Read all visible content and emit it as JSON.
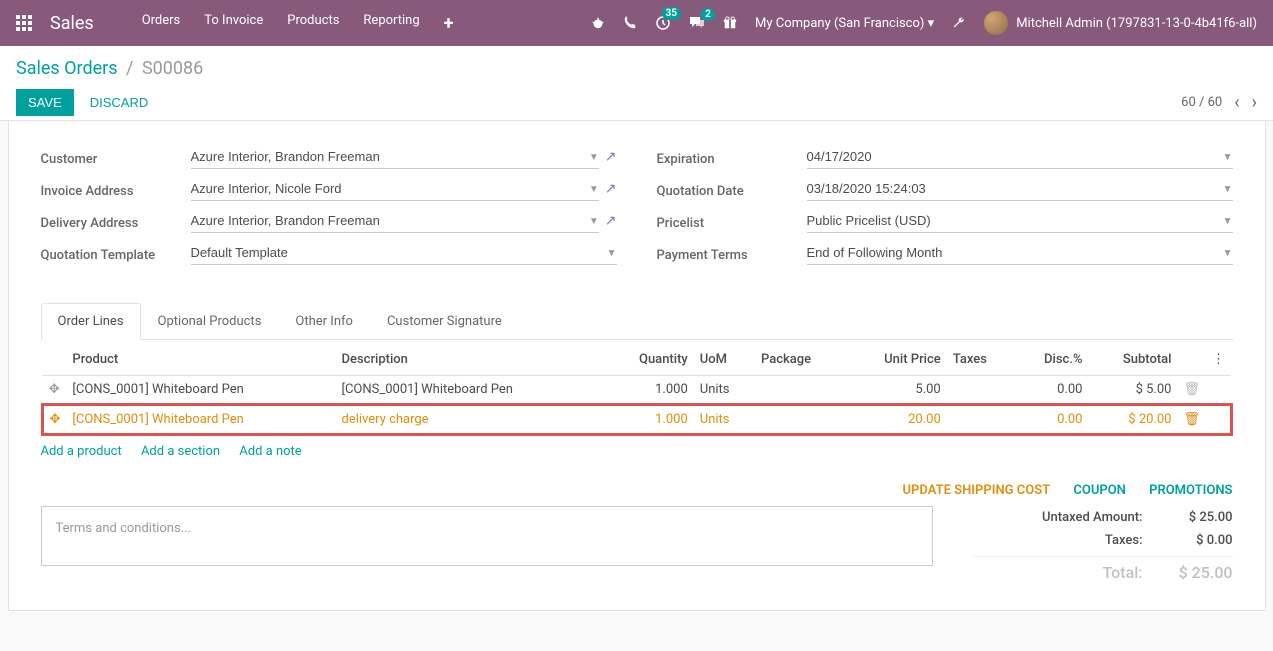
{
  "navbar": {
    "title": "Sales",
    "menu": [
      "Orders",
      "To Invoice",
      "Products",
      "Reporting"
    ],
    "activity_count": "35",
    "message_count": "2",
    "company": "My Company (San Francisco)",
    "user": "Mitchell Admin (1797831-13-0-4b41f6-all)"
  },
  "breadcrumb": {
    "parent": "Sales Orders",
    "current": "S00086"
  },
  "buttons": {
    "save": "SAVE",
    "discard": "DISCARD"
  },
  "pager": "60 / 60",
  "form": {
    "left": {
      "customer_label": "Customer",
      "customer": "Azure Interior, Brandon Freeman",
      "invoice_addr_label": "Invoice Address",
      "invoice_addr": "Azure Interior, Nicole Ford",
      "delivery_addr_label": "Delivery Address",
      "delivery_addr": "Azure Interior, Brandon Freeman",
      "template_label": "Quotation Template",
      "template": "Default Template"
    },
    "right": {
      "expiration_label": "Expiration",
      "expiration": "04/17/2020",
      "date_label": "Quotation Date",
      "date": "03/18/2020 15:24:03",
      "pricelist_label": "Pricelist",
      "pricelist": "Public Pricelist (USD)",
      "terms_label": "Payment Terms",
      "terms": "End of Following Month"
    }
  },
  "tabs": [
    "Order Lines",
    "Optional Products",
    "Other Info",
    "Customer Signature"
  ],
  "table": {
    "headers": {
      "product": "Product",
      "description": "Description",
      "quantity": "Quantity",
      "uom": "UoM",
      "package": "Package",
      "unit_price": "Unit Price",
      "taxes": "Taxes",
      "discount": "Disc.%",
      "subtotal": "Subtotal"
    },
    "rows": [
      {
        "product": "[CONS_0001] Whiteboard Pen",
        "description": "[CONS_0001] Whiteboard Pen",
        "quantity": "1.000",
        "uom": "Units",
        "package": "",
        "unit_price": "5.00",
        "taxes": "",
        "discount": "0.00",
        "subtotal": "$ 5.00"
      },
      {
        "product": "[CONS_0001] Whiteboard Pen",
        "description": "delivery charge",
        "quantity": "1.000",
        "uom": "Units",
        "package": "",
        "unit_price": "20.00",
        "taxes": "",
        "discount": "0.00",
        "subtotal": "$ 20.00"
      }
    ],
    "add_product": "Add a product",
    "add_section": "Add a section",
    "add_note": "Add a note"
  },
  "bottom_actions": {
    "shipping": "UPDATE SHIPPING COST",
    "coupon": "COUPON",
    "promotions": "PROMOTIONS"
  },
  "terms_placeholder": "Terms and conditions...",
  "totals": {
    "untaxed_label": "Untaxed Amount:",
    "untaxed": "$ 25.00",
    "taxes_label": "Taxes:",
    "taxes": "$ 0.00",
    "total_label": "Total:",
    "total": "$ 25.00"
  }
}
